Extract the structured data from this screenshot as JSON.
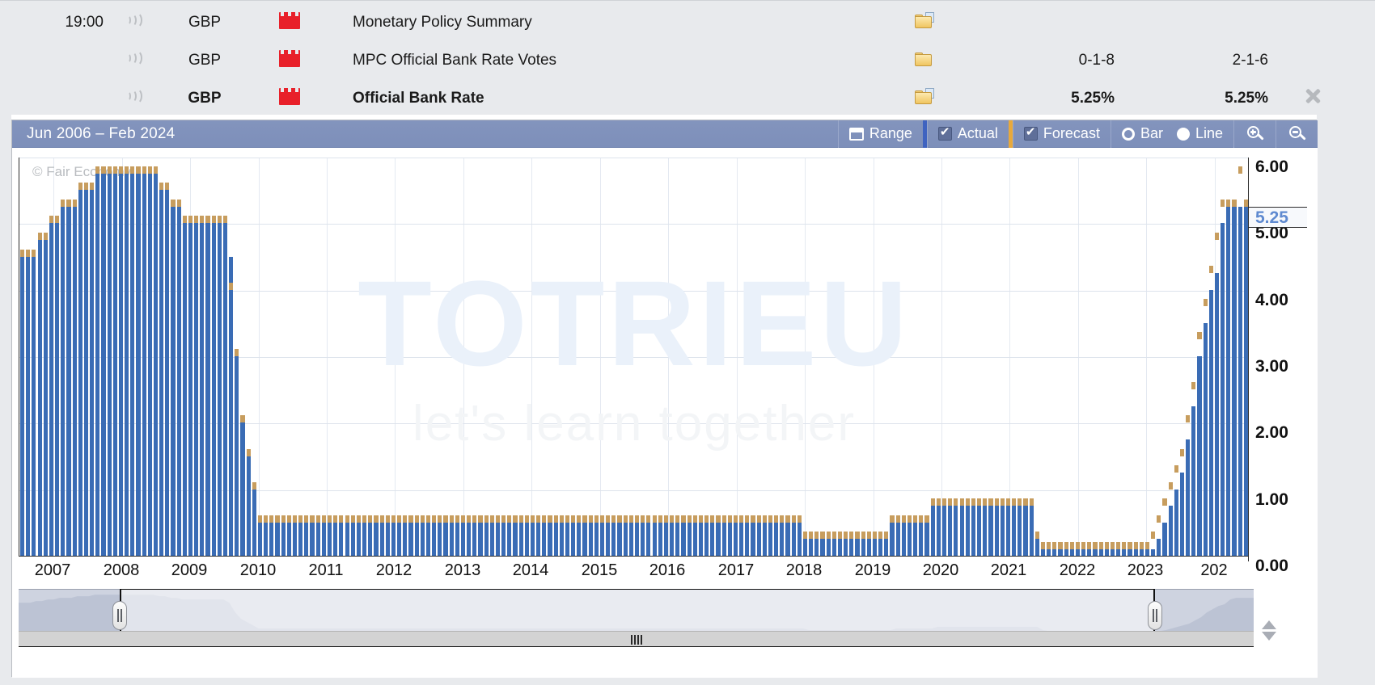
{
  "calendar": {
    "rows": [
      {
        "time": "19:00",
        "alert_icon": "speaker-icon",
        "currency": "GBP",
        "impact_icon": "high-impact-icon",
        "title": "Monetary Policy Summary",
        "detail_icon": "folder-with-page-icon",
        "actual": "",
        "forecast": "",
        "bold": false
      },
      {
        "time": "",
        "alert_icon": "speaker-icon",
        "currency": "GBP",
        "impact_icon": "high-impact-icon",
        "title": "MPC Official Bank Rate Votes",
        "detail_icon": "folder-icon",
        "actual": "0-1-8",
        "forecast": "2-1-6",
        "bold": false
      },
      {
        "time": "",
        "alert_icon": "speaker-icon",
        "currency": "GBP",
        "impact_icon": "high-impact-icon",
        "title": "Official Bank Rate",
        "detail_icon": "folder-with-page-icon",
        "actual": "5.25%",
        "forecast": "5.25%",
        "bold": true
      }
    ],
    "close_icon": "close-icon"
  },
  "toolbar": {
    "title": "Jun 2006 – Feb 2024",
    "range_label": "Range",
    "range_icon": "calendar-icon",
    "actual_label": "Actual",
    "actual_checked": true,
    "forecast_label": "Forecast",
    "forecast_checked": true,
    "bar_label": "Bar",
    "line_label": "Line",
    "chart_type_selected": "Line",
    "zoom_in_icon": "magnifier-plus-icon",
    "zoom_out_icon": "magnifier-minus-icon"
  },
  "chart": {
    "copyright": "© Fair Economy",
    "watermark_top": "TOTRIEU",
    "watermark_bottom": "let's learn together",
    "current_value_label": "5.25",
    "bar_color": "#3a6cb5",
    "forecast_color": "#c79d5e",
    "highlight_color": "#5f8ad0"
  },
  "chart_data": {
    "type": "bar",
    "title": "Jun 2006 – Feb 2024",
    "xlabel": "",
    "ylabel": "",
    "ylim": [
      0,
      6.0
    ],
    "yticks": [
      "0.00",
      "1.00",
      "2.00",
      "3.00",
      "4.00",
      "5.00",
      "6.00"
    ],
    "ytick_values": [
      0,
      1,
      2,
      3,
      4,
      5,
      6
    ],
    "xticks": [
      "2007",
      "2008",
      "2009",
      "2010",
      "2011",
      "2012",
      "2013",
      "2014",
      "2015",
      "2016",
      "2017",
      "2018",
      "2019",
      "2020",
      "2021",
      "2022",
      "2023",
      "202"
    ],
    "grid": true,
    "legend": [
      "Actual",
      "Forecast"
    ],
    "legend_position": "toolbar",
    "current_marker": 5.25,
    "series": [
      {
        "name": "Actual",
        "values": [
          4.5,
          4.5,
          4.5,
          4.75,
          4.75,
          5.0,
          5.0,
          5.25,
          5.25,
          5.25,
          5.5,
          5.5,
          5.5,
          5.75,
          5.75,
          5.75,
          5.75,
          5.75,
          5.75,
          5.75,
          5.75,
          5.75,
          5.75,
          5.75,
          5.5,
          5.5,
          5.25,
          5.25,
          5.0,
          5.0,
          5.0,
          5.0,
          5.0,
          5.0,
          5.0,
          5.0,
          4.5,
          3.0,
          2.0,
          1.5,
          1.0,
          0.5,
          0.5,
          0.5,
          0.5,
          0.5,
          0.5,
          0.5,
          0.5,
          0.5,
          0.5,
          0.5,
          0.5,
          0.5,
          0.5,
          0.5,
          0.5,
          0.5,
          0.5,
          0.5,
          0.5,
          0.5,
          0.5,
          0.5,
          0.5,
          0.5,
          0.5,
          0.5,
          0.5,
          0.5,
          0.5,
          0.5,
          0.5,
          0.5,
          0.5,
          0.5,
          0.5,
          0.5,
          0.5,
          0.5,
          0.5,
          0.5,
          0.5,
          0.5,
          0.5,
          0.5,
          0.5,
          0.5,
          0.5,
          0.5,
          0.5,
          0.5,
          0.5,
          0.5,
          0.5,
          0.5,
          0.5,
          0.5,
          0.5,
          0.5,
          0.5,
          0.5,
          0.5,
          0.5,
          0.5,
          0.5,
          0.5,
          0.5,
          0.5,
          0.5,
          0.5,
          0.5,
          0.5,
          0.5,
          0.5,
          0.5,
          0.5,
          0.5,
          0.5,
          0.5,
          0.5,
          0.5,
          0.5,
          0.5,
          0.5,
          0.5,
          0.5,
          0.5,
          0.5,
          0.5,
          0.5,
          0.5,
          0.5,
          0.5,
          0.5,
          0.25,
          0.25,
          0.25,
          0.25,
          0.25,
          0.25,
          0.25,
          0.25,
          0.25,
          0.25,
          0.25,
          0.25,
          0.25,
          0.25,
          0.25,
          0.5,
          0.5,
          0.5,
          0.5,
          0.5,
          0.5,
          0.5,
          0.75,
          0.75,
          0.75,
          0.75,
          0.75,
          0.75,
          0.75,
          0.75,
          0.75,
          0.75,
          0.75,
          0.75,
          0.75,
          0.75,
          0.75,
          0.75,
          0.75,
          0.75,
          0.25,
          0.1,
          0.1,
          0.1,
          0.1,
          0.1,
          0.1,
          0.1,
          0.1,
          0.1,
          0.1,
          0.1,
          0.1,
          0.1,
          0.1,
          0.1,
          0.1,
          0.1,
          0.1,
          0.1,
          0.1,
          0.25,
          0.5,
          0.75,
          1.0,
          1.25,
          1.75,
          2.25,
          3.0,
          3.5,
          4.0,
          4.25,
          5.0,
          5.25,
          5.25,
          5.25,
          5.25
        ]
      },
      {
        "name": "Forecast",
        "values": [
          4.5,
          4.5,
          4.5,
          4.75,
          4.75,
          5.0,
          5.0,
          5.25,
          5.25,
          5.25,
          5.5,
          5.5,
          5.5,
          5.75,
          5.75,
          5.75,
          5.75,
          5.75,
          5.75,
          5.75,
          5.75,
          5.75,
          5.75,
          5.75,
          5.5,
          5.5,
          5.25,
          5.25,
          5.0,
          5.0,
          5.0,
          5.0,
          5.0,
          5.0,
          5.0,
          5.0,
          4.0,
          3.0,
          2.0,
          1.5,
          1.0,
          0.5,
          0.5,
          0.5,
          0.5,
          0.5,
          0.5,
          0.5,
          0.5,
          0.5,
          0.5,
          0.5,
          0.5,
          0.5,
          0.5,
          0.5,
          0.5,
          0.5,
          0.5,
          0.5,
          0.5,
          0.5,
          0.5,
          0.5,
          0.5,
          0.5,
          0.5,
          0.5,
          0.5,
          0.5,
          0.5,
          0.5,
          0.5,
          0.5,
          0.5,
          0.5,
          0.5,
          0.5,
          0.5,
          0.5,
          0.5,
          0.5,
          0.5,
          0.5,
          0.5,
          0.5,
          0.5,
          0.5,
          0.5,
          0.5,
          0.5,
          0.5,
          0.5,
          0.5,
          0.5,
          0.5,
          0.5,
          0.5,
          0.5,
          0.5,
          0.5,
          0.5,
          0.5,
          0.5,
          0.5,
          0.5,
          0.5,
          0.5,
          0.5,
          0.5,
          0.5,
          0.5,
          0.5,
          0.5,
          0.5,
          0.5,
          0.5,
          0.5,
          0.5,
          0.5,
          0.5,
          0.5,
          0.5,
          0.5,
          0.5,
          0.5,
          0.5,
          0.5,
          0.5,
          0.5,
          0.5,
          0.5,
          0.5,
          0.5,
          0.5,
          0.25,
          0.25,
          0.25,
          0.25,
          0.25,
          0.25,
          0.25,
          0.25,
          0.25,
          0.25,
          0.25,
          0.25,
          0.25,
          0.25,
          0.25,
          0.5,
          0.5,
          0.5,
          0.5,
          0.5,
          0.5,
          0.5,
          0.75,
          0.75,
          0.75,
          0.75,
          0.75,
          0.75,
          0.75,
          0.75,
          0.75,
          0.75,
          0.75,
          0.75,
          0.75,
          0.75,
          0.75,
          0.75,
          0.75,
          0.75,
          0.25,
          0.1,
          0.1,
          0.1,
          0.1,
          0.1,
          0.1,
          0.1,
          0.1,
          0.1,
          0.1,
          0.1,
          0.1,
          0.1,
          0.1,
          0.1,
          0.1,
          0.1,
          0.1,
          0.1,
          0.25,
          0.5,
          0.75,
          1.0,
          1.25,
          1.5,
          2.0,
          2.5,
          3.25,
          3.75,
          4.25,
          4.75,
          5.25,
          5.25,
          5.25,
          5.75,
          5.25
        ]
      }
    ]
  },
  "navigator": {
    "left_handle_icon": "range-handle-left",
    "right_handle_icon": "range-handle-right",
    "scrollbar_grip_icon": "scrollbar-grip",
    "stepper_up_icon": "chevron-up-icon",
    "stepper_down_icon": "chevron-down-icon"
  }
}
